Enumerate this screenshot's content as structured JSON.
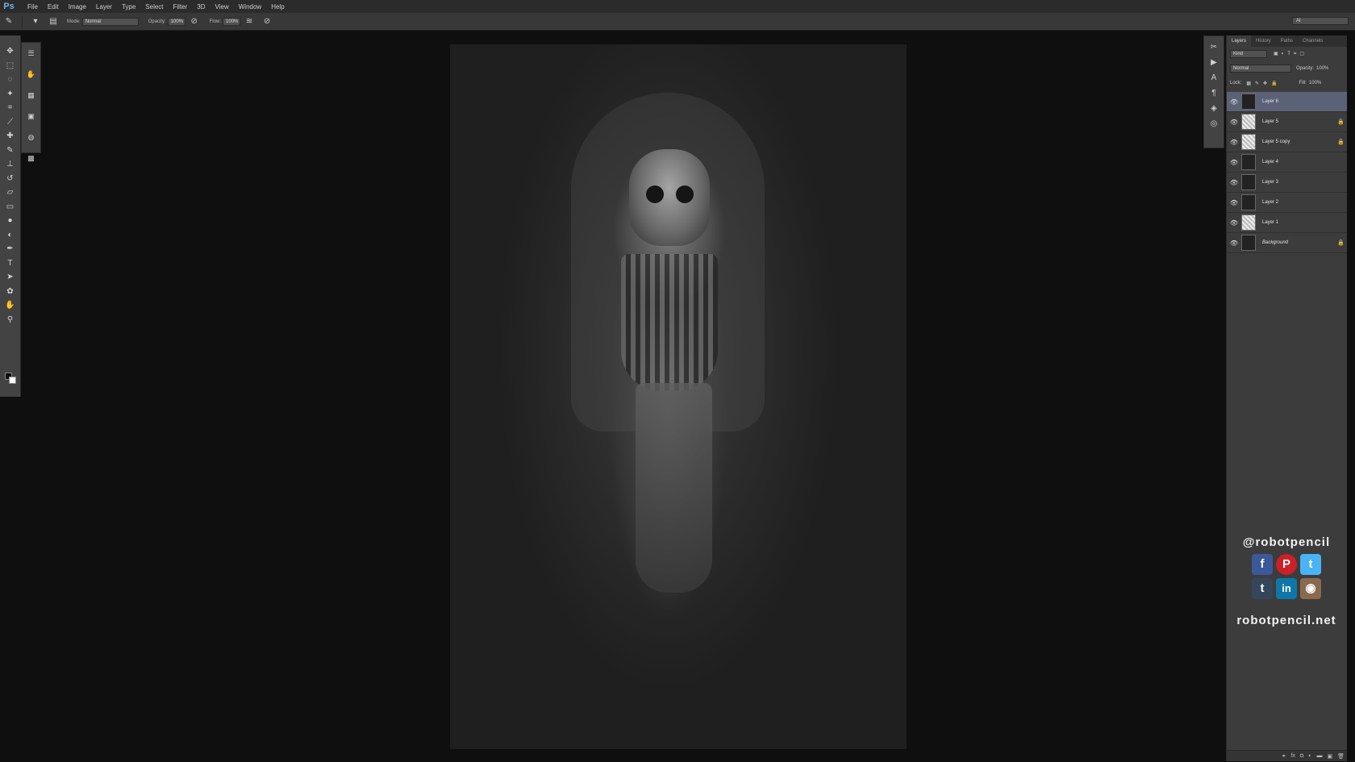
{
  "app": {
    "logo": "Ps"
  },
  "menu": [
    "File",
    "Edit",
    "Image",
    "Layer",
    "Type",
    "Select",
    "Filter",
    "3D",
    "View",
    "Window",
    "Help"
  ],
  "options": {
    "mode_label": "Mode:",
    "mode_value": "Normal",
    "opacity_label": "Opacity:",
    "opacity_value": "100%",
    "flow_label": "Flow:",
    "flow_value": "100%"
  },
  "workspace": {
    "value": "AI"
  },
  "tools": [
    "move-tool",
    "marquee-tool",
    "lasso-tool",
    "quick-select-tool",
    "crop-tool",
    "eyedropper-tool",
    "healing-brush-tool",
    "brush-tool",
    "clone-stamp-tool",
    "history-brush-tool",
    "eraser-tool",
    "gradient-tool",
    "blur-tool",
    "dodge-tool",
    "pen-tool",
    "type-tool",
    "path-select-tool",
    "shape-tool",
    "hand-tool",
    "zoom-tool"
  ],
  "layers_panel": {
    "tabs": [
      "Layers",
      "History",
      "Paths",
      "Channels"
    ],
    "filter_value": "Kind",
    "blend_value": "Normal",
    "opacity_label": "Opacity:",
    "opacity_value": "100%",
    "lock_label": "Lock:",
    "fill_label": "Fill:",
    "fill_value": "100%",
    "layers": [
      {
        "name": "Layer 6",
        "selected": true,
        "locked": false,
        "thumb": "dark"
      },
      {
        "name": "Layer 5",
        "selected": false,
        "locked": true,
        "thumb": "light"
      },
      {
        "name": "Layer 5 copy",
        "selected": false,
        "locked": true,
        "thumb": "light"
      },
      {
        "name": "Layer 4",
        "selected": false,
        "locked": false,
        "thumb": "dark"
      },
      {
        "name": "Layer 3",
        "selected": false,
        "locked": false,
        "thumb": "dark"
      },
      {
        "name": "Layer 2",
        "selected": false,
        "locked": false,
        "thumb": "dark"
      },
      {
        "name": "Layer 1",
        "selected": false,
        "locked": false,
        "thumb": "light"
      },
      {
        "name": "Background",
        "selected": false,
        "locked": true,
        "thumb": "dark",
        "italic": true
      }
    ]
  },
  "promo": {
    "handle": "@robotpencil",
    "site": "robotpencil.net",
    "social": [
      {
        "name": "facebook-icon",
        "glyph": "f",
        "color": "#3b5998"
      },
      {
        "name": "pinterest-icon",
        "glyph": "P",
        "color": "#cb2027"
      },
      {
        "name": "twitter-icon",
        "glyph": "t",
        "color": "#4ab3f4"
      },
      {
        "name": "tumblr-icon",
        "glyph": "t",
        "color": "#35465c"
      },
      {
        "name": "linkedin-icon",
        "glyph": "in",
        "color": "#0e76a8"
      },
      {
        "name": "instagram-icon",
        "glyph": "◉",
        "color": "#8a6a4f"
      }
    ]
  },
  "colors": {
    "selected_layer": "#5b6278",
    "panel": "#3c3c3c",
    "canvas_bg": "#0e0f0e"
  }
}
